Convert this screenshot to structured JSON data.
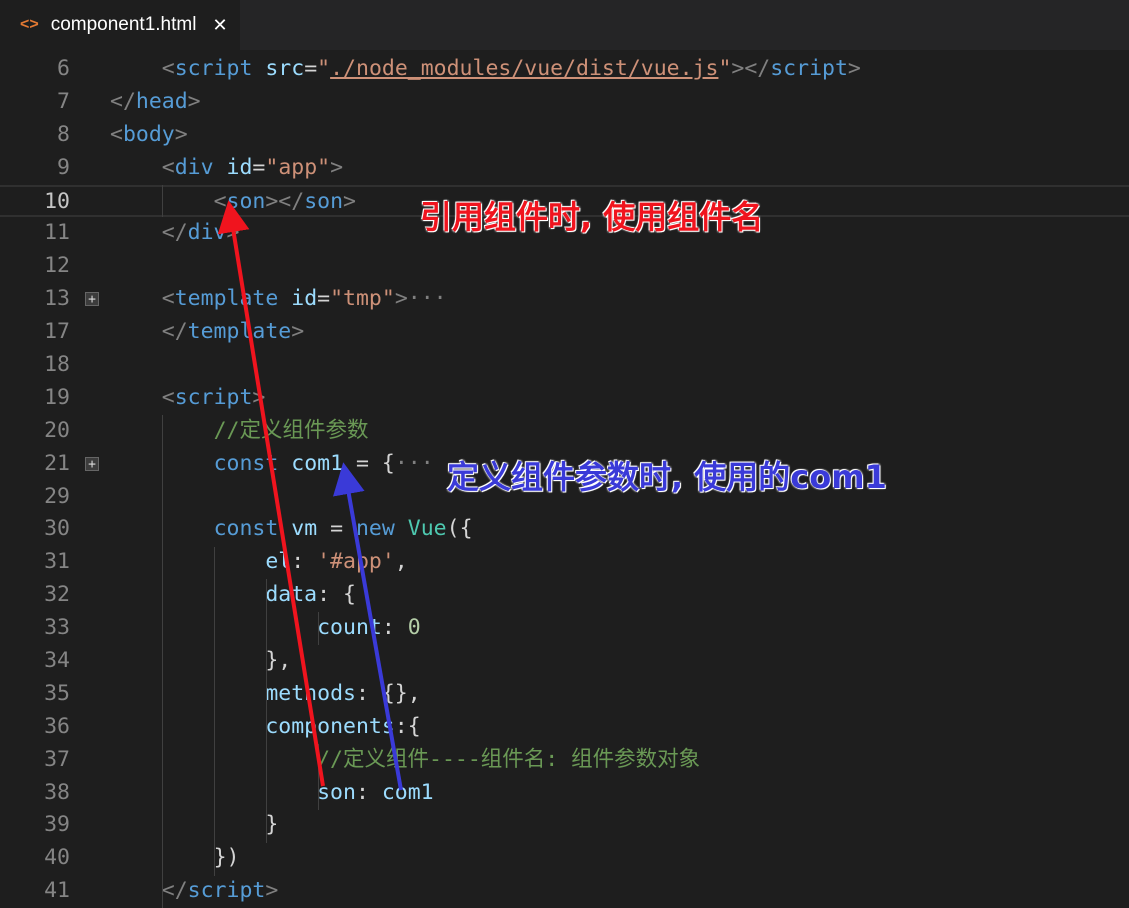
{
  "tab": {
    "icon": "code-icon",
    "title": "component1.html",
    "close": "✕"
  },
  "lines": [
    {
      "n": "6",
      "tokens": [
        [
          "    ",
          "p"
        ],
        [
          "<",
          "b"
        ],
        [
          "script",
          "t"
        ],
        [
          " ",
          "p"
        ],
        [
          "src",
          "a"
        ],
        [
          "=",
          "p"
        ],
        [
          "\"",
          "s"
        ],
        [
          "./node_modules/vue/dist/vue.js",
          "u"
        ],
        [
          "\"",
          "s"
        ],
        [
          "></",
          "b"
        ],
        [
          "script",
          "t"
        ],
        [
          ">",
          "b"
        ]
      ]
    },
    {
      "n": "7",
      "tokens": [
        [
          "</",
          "b"
        ],
        [
          "head",
          "t"
        ],
        [
          ">",
          "b"
        ]
      ]
    },
    {
      "n": "8",
      "tokens": [
        [
          "<",
          "b"
        ],
        [
          "body",
          "t"
        ],
        [
          ">",
          "b"
        ]
      ]
    },
    {
      "n": "9",
      "tokens": [
        [
          "    ",
          "p"
        ],
        [
          "<",
          "b"
        ],
        [
          "div",
          "t"
        ],
        [
          " ",
          "p"
        ],
        [
          "id",
          "a"
        ],
        [
          "=",
          "p"
        ],
        [
          "\"app\"",
          "s"
        ],
        [
          ">",
          "b"
        ]
      ]
    },
    {
      "n": "10",
      "current": true,
      "tokens": [
        [
          "        ",
          "p"
        ],
        [
          "<",
          "b"
        ],
        [
          "son",
          "t"
        ],
        [
          "></",
          "b"
        ],
        [
          "son",
          "t"
        ],
        [
          ">",
          "b"
        ]
      ]
    },
    {
      "n": "11",
      "tokens": [
        [
          "    ",
          "p"
        ],
        [
          "</",
          "b"
        ],
        [
          "div",
          "t"
        ],
        [
          ">",
          "b"
        ]
      ]
    },
    {
      "n": "12",
      "tokens": []
    },
    {
      "n": "13",
      "fold": true,
      "tokens": [
        [
          "    ",
          "p"
        ],
        [
          "<",
          "b"
        ],
        [
          "template",
          "t"
        ],
        [
          " ",
          "p"
        ],
        [
          "id",
          "a"
        ],
        [
          "=",
          "p"
        ],
        [
          "\"tmp\"",
          "s"
        ],
        [
          ">",
          "b"
        ],
        [
          "···",
          "b"
        ]
      ]
    },
    {
      "n": "17",
      "tokens": [
        [
          "    ",
          "p"
        ],
        [
          "</",
          "b"
        ],
        [
          "template",
          "t"
        ],
        [
          ">",
          "b"
        ]
      ]
    },
    {
      "n": "18",
      "tokens": []
    },
    {
      "n": "19",
      "tokens": [
        [
          "    ",
          "p"
        ],
        [
          "<",
          "b"
        ],
        [
          "script",
          "t"
        ],
        [
          ">",
          "b"
        ]
      ]
    },
    {
      "n": "20",
      "tokens": [
        [
          "        ",
          "p"
        ],
        [
          "//定义组件参数",
          "c"
        ]
      ]
    },
    {
      "n": "21",
      "fold": true,
      "tokens": [
        [
          "        ",
          "p"
        ],
        [
          "const",
          "k"
        ],
        [
          " ",
          "p"
        ],
        [
          "com1",
          "v"
        ],
        [
          " = {",
          "p"
        ],
        [
          "···",
          "b"
        ]
      ]
    },
    {
      "n": "29",
      "tokens": []
    },
    {
      "n": "30",
      "tokens": [
        [
          "        ",
          "p"
        ],
        [
          "const",
          "k"
        ],
        [
          " ",
          "p"
        ],
        [
          "vm",
          "v"
        ],
        [
          " = ",
          "p"
        ],
        [
          "new",
          "k"
        ],
        [
          " ",
          "p"
        ],
        [
          "Vue",
          "cl"
        ],
        [
          "({",
          "p"
        ]
      ]
    },
    {
      "n": "31",
      "tokens": [
        [
          "            ",
          "p"
        ],
        [
          "el",
          "v"
        ],
        [
          ": ",
          "p"
        ],
        [
          "'#app'",
          "s"
        ],
        [
          ",",
          "p"
        ]
      ]
    },
    {
      "n": "32",
      "tokens": [
        [
          "            ",
          "p"
        ],
        [
          "data",
          "v"
        ],
        [
          ": {",
          "p"
        ]
      ]
    },
    {
      "n": "33",
      "tokens": [
        [
          "                ",
          "p"
        ],
        [
          "count",
          "v"
        ],
        [
          ": ",
          "p"
        ],
        [
          "0",
          "n"
        ]
      ]
    },
    {
      "n": "34",
      "tokens": [
        [
          "            ",
          "p"
        ],
        [
          "},",
          "p"
        ]
      ]
    },
    {
      "n": "35",
      "tokens": [
        [
          "            ",
          "p"
        ],
        [
          "methods",
          "v"
        ],
        [
          ": {},",
          "p"
        ]
      ]
    },
    {
      "n": "36",
      "tokens": [
        [
          "            ",
          "p"
        ],
        [
          "components",
          "v"
        ],
        [
          ":{",
          "p"
        ]
      ]
    },
    {
      "n": "37",
      "tokens": [
        [
          "                ",
          "p"
        ],
        [
          "//定义组件----组件名: 组件参数对象",
          "c"
        ]
      ]
    },
    {
      "n": "38",
      "tokens": [
        [
          "                ",
          "p"
        ],
        [
          "son",
          "v"
        ],
        [
          ": ",
          "p"
        ],
        [
          "com1",
          "v"
        ]
      ]
    },
    {
      "n": "39",
      "tokens": [
        [
          "            ",
          "p"
        ],
        [
          "}",
          "p"
        ]
      ]
    },
    {
      "n": "40",
      "tokens": [
        [
          "        ",
          "p"
        ],
        [
          "})",
          "p"
        ]
      ]
    },
    {
      "n": "41",
      "tokens": [
        [
          "    ",
          "p"
        ],
        [
          "</",
          "b"
        ],
        [
          "script",
          "t"
        ],
        [
          ">",
          "b"
        ]
      ]
    }
  ],
  "annotations": {
    "red": {
      "text": "引用组件时, 使用组件名",
      "color": "#f0141e"
    },
    "blue": {
      "text": "定义组件参数时, 使用的com1",
      "color": "#3a3ad8"
    }
  }
}
